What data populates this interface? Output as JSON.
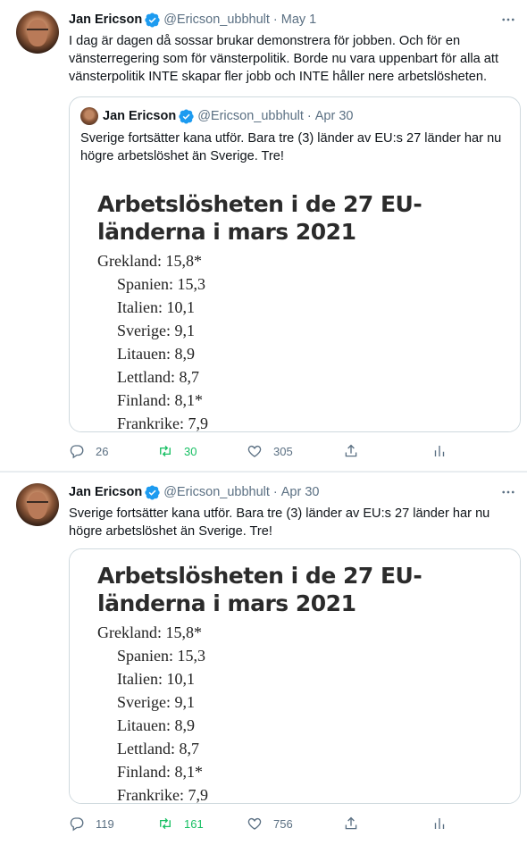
{
  "tweets": [
    {
      "author": {
        "name": "Jan Ericson",
        "handle": "@Ericson_ubbhult",
        "date": "May 1"
      },
      "text": "I dag är dagen då sossar brukar demonstrera för jobben. Och för en vänsterregering som för vänsterpolitik. Borde nu vara uppenbart för alla att vänsterpolitik INTE skapar fler jobb och INTE håller nere arbetslösheten.",
      "quote": {
        "author": {
          "name": "Jan Ericson",
          "handle": "@Ericson_ubbhult",
          "date": "Apr 30"
        },
        "text": "Sverige fortsätter kana utför. Bara tre   (3) länder av EU:s 27 länder har nu högre arbetslöshet än Sverige. Tre!"
      },
      "stats": {
        "replies": "26",
        "retweets": "30",
        "likes": "305"
      }
    },
    {
      "author": {
        "name": "Jan Ericson",
        "handle": "@Ericson_ubbhult",
        "date": "Apr 30"
      },
      "text": "Sverige fortsätter kana utför. Bara tre   (3) länder av EU:s 27 länder har nu högre arbetslöshet än Sverige. Tre!",
      "stats": {
        "replies": "119",
        "retweets": "161",
        "likes": "756"
      }
    }
  ],
  "media_image": {
    "title": "Arbetslösheten i de 27 EU-länderna i mars 2021",
    "lines": [
      "Grekland: 15,8*",
      "Spanien: 15,3",
      "Italien: 10,1",
      "Sverige: 9,1",
      "Litauen: 8,9",
      "Lettland: 8,7",
      "Finland: 8,1*",
      "Frankrike: 7,9"
    ]
  },
  "colors": {
    "text": "#0f1419",
    "secondary": "#5b7083",
    "verified": "#1d9bf0",
    "retweet_active": "#17bf63",
    "border": "#cfd9de"
  },
  "icons": [
    "verified-badge-icon",
    "more-icon",
    "reply-icon",
    "retweet-icon",
    "like-icon",
    "share-icon",
    "analytics-icon"
  ]
}
